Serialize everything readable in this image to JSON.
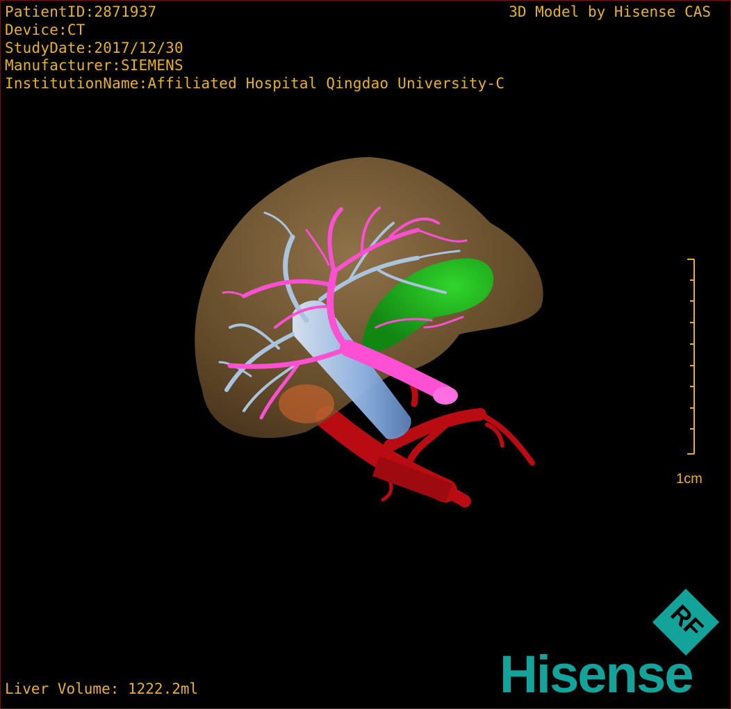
{
  "overlay": {
    "patient_id": "PatientID:2871937",
    "device": "Device:CT",
    "study_date": "StudyDate:2017/12/30",
    "manufacturer": "Manufacturer:SIEMENS",
    "institution": "InstitutionName:Affiliated Hospital Qingdao University-C",
    "credit": "3D Model by Hisense CAS",
    "volume": "Liver Volume: 1222.2ml"
  },
  "scale": {
    "label": "1cm"
  },
  "brand": {
    "logo_text": "RF",
    "name": "Hisense"
  },
  "colors": {
    "overlay_text": "#e8b225",
    "liver": "#8a6a3c",
    "portal_vein": "#ff4fd2",
    "hepatic_vein": "#aac4de",
    "artery": "#b80c12",
    "ivc": "#a9c8ee",
    "gallbladder": "#18b018",
    "brand": "#14a39b"
  }
}
